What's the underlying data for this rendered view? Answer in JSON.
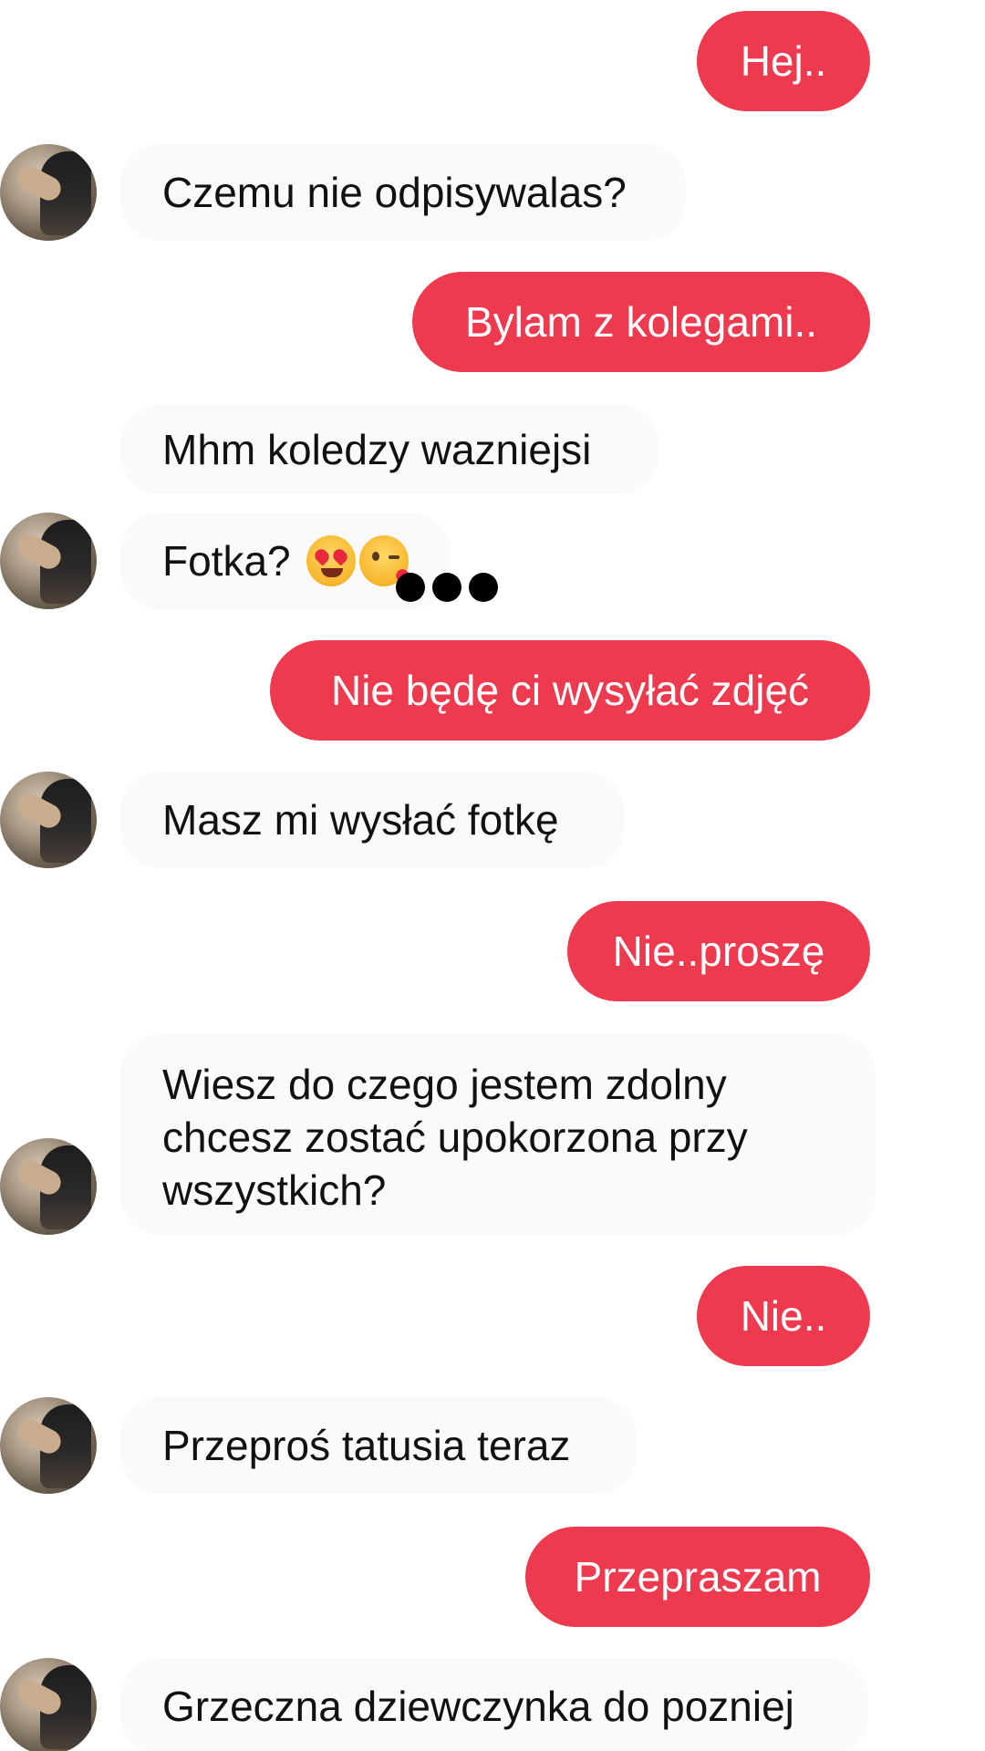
{
  "conversation": {
    "messages": [
      {
        "from": "me",
        "text": "Hej.."
      },
      {
        "from": "them",
        "text": "Czemu nie odpisywalas?"
      },
      {
        "from": "me",
        "text": "Bylam z kolegami.."
      },
      {
        "from": "them",
        "text": "Mhm koledzy wazniejsi"
      },
      {
        "from": "them",
        "text": "Fotka?",
        "emojis": [
          "heart-eyes-emoji",
          "kissing-face-emoji"
        ]
      },
      {
        "from": "me",
        "text": "Nie będę ci wysyłać zdjęć"
      },
      {
        "from": "them",
        "text": "Masz mi wysłać fotkę"
      },
      {
        "from": "me",
        "text": "Nie..proszę"
      },
      {
        "from": "them",
        "text": "Wiesz do czego jestem zdolny chcesz zostać upokorzona przy wszystkich?"
      },
      {
        "from": "me",
        "text": "Nie.."
      },
      {
        "from": "them",
        "text": "Przeproś tatusia teraz"
      },
      {
        "from": "me",
        "text": "Przepraszam"
      },
      {
        "from": "them",
        "text": "Grzeczna dziewczynka do pozniej"
      }
    ]
  },
  "colors": {
    "outgoing_bubble": "#ee3a4f",
    "incoming_bubble": "#fafafb",
    "typing_dots": "#000000"
  },
  "icons": {
    "avatar": "contact-avatar-photo",
    "typing": "typing-indicator-dots"
  }
}
